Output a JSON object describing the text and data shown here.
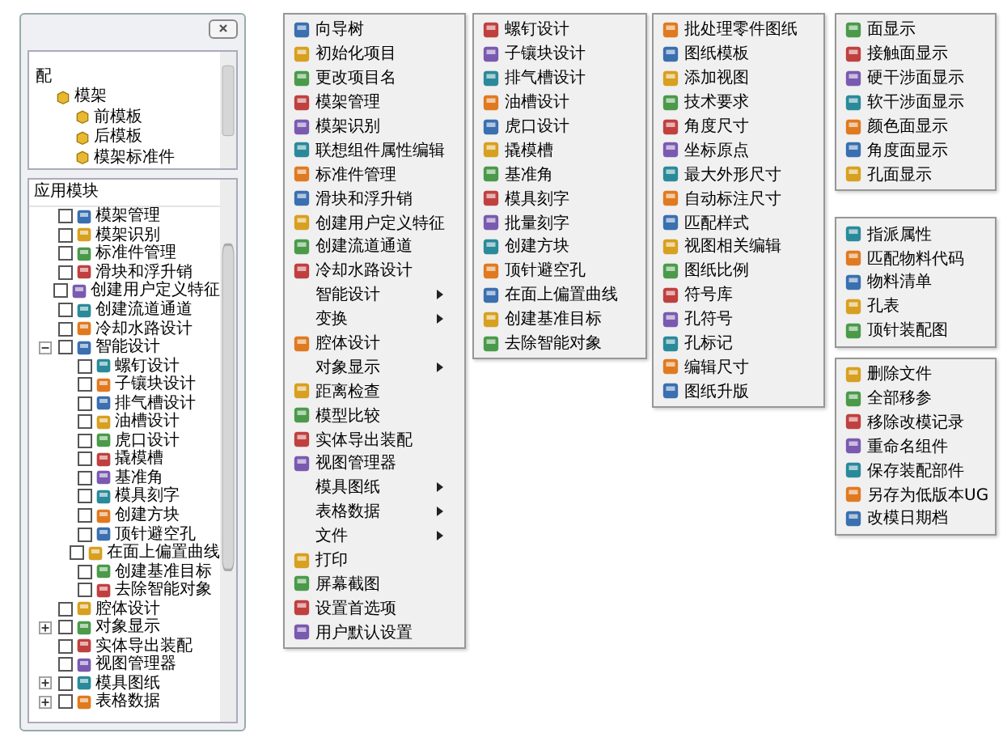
{
  "panel": {
    "top_tree": [
      {
        "label": "配",
        "children": [
          {
            "label": "模架",
            "children": [
              {
                "label": "前模板"
              },
              {
                "label": "后模板"
              },
              {
                "label": "模架标准件"
              }
            ]
          }
        ]
      }
    ],
    "app_modules": {
      "header": "应用模块",
      "items": [
        {
          "label": "模架管理",
          "checked": false
        },
        {
          "label": "模架识别",
          "checked": false
        },
        {
          "label": "标准件管理",
          "checked": false
        },
        {
          "label": "滑块和浮升销",
          "checked": false
        },
        {
          "label": "创建用户定义特征",
          "checked": false
        },
        {
          "label": "创建流道通道",
          "checked": false
        },
        {
          "label": "冷却水路设计",
          "checked": false
        },
        {
          "label": "智能设计",
          "checked": false,
          "expanded": true,
          "children": [
            {
              "label": "螺钉设计",
              "checked": false
            },
            {
              "label": "子镶块设计",
              "checked": false
            },
            {
              "label": "排气槽设计",
              "checked": false
            },
            {
              "label": "油槽设计",
              "checked": false
            },
            {
              "label": "虎口设计",
              "checked": false
            },
            {
              "label": "撬模槽",
              "checked": false
            },
            {
              "label": "基准角",
              "checked": false
            },
            {
              "label": "模具刻字",
              "checked": false
            },
            {
              "label": "创建方块",
              "checked": false
            },
            {
              "label": "顶针避空孔",
              "checked": false
            },
            {
              "label": "在面上偏置曲线",
              "checked": false
            },
            {
              "label": "创建基准目标",
              "checked": false
            },
            {
              "label": "去除智能对象",
              "checked": false
            }
          ]
        },
        {
          "label": "腔体设计",
          "checked": false
        },
        {
          "label": "对象显示",
          "checked": false,
          "expanded": false
        },
        {
          "label": "实体导出装配",
          "checked": false
        },
        {
          "label": "视图管理器",
          "checked": false
        },
        {
          "label": "模具图纸",
          "checked": false,
          "expanded": false
        },
        {
          "label": "表格数据",
          "checked": false,
          "expanded": false
        }
      ]
    }
  },
  "menus": [
    {
      "items": [
        {
          "label": "向导树",
          "kind": "command"
        },
        {
          "label": "初始化项目",
          "kind": "command"
        },
        {
          "label": "更改项目名",
          "kind": "command"
        },
        {
          "label": "模架管理",
          "kind": "command"
        },
        {
          "label": "模架识别",
          "kind": "command"
        },
        {
          "label": "联想组件属性编辑",
          "kind": "command"
        },
        {
          "label": "标准件管理",
          "kind": "command"
        },
        {
          "label": "滑块和浮升销",
          "kind": "command"
        },
        {
          "label": "创建用户定义特征",
          "kind": "command"
        },
        {
          "label": "创建流道通道",
          "kind": "command"
        },
        {
          "label": "冷却水路设计",
          "kind": "command"
        },
        {
          "label": "智能设计",
          "kind": "submenu"
        },
        {
          "label": "变换",
          "kind": "submenu"
        },
        {
          "label": "腔体设计",
          "kind": "command"
        },
        {
          "label": "对象显示",
          "kind": "submenu"
        },
        {
          "label": "距离检查",
          "kind": "command"
        },
        {
          "label": "模型比较",
          "kind": "command"
        },
        {
          "label": "实体导出装配",
          "kind": "command"
        },
        {
          "label": "视图管理器",
          "kind": "command"
        },
        {
          "label": "模具图纸",
          "kind": "submenu"
        },
        {
          "label": "表格数据",
          "kind": "submenu"
        },
        {
          "label": "文件",
          "kind": "submenu"
        },
        {
          "label": "打印",
          "kind": "command"
        },
        {
          "label": "屏幕截图",
          "kind": "command"
        },
        {
          "label": "设置首选项",
          "kind": "command"
        },
        {
          "label": "用户默认设置",
          "kind": "command"
        }
      ]
    },
    {
      "items": [
        {
          "label": "螺钉设计",
          "kind": "command"
        },
        {
          "label": "子镶块设计",
          "kind": "command"
        },
        {
          "label": "排气槽设计",
          "kind": "command"
        },
        {
          "label": "油槽设计",
          "kind": "command"
        },
        {
          "label": "虎口设计",
          "kind": "command"
        },
        {
          "label": "撬模槽",
          "kind": "command"
        },
        {
          "label": "基准角",
          "kind": "command"
        },
        {
          "label": "模具刻字",
          "kind": "command"
        },
        {
          "label": "批量刻字",
          "kind": "command"
        },
        {
          "label": "创建方块",
          "kind": "command"
        },
        {
          "label": "顶针避空孔",
          "kind": "command"
        },
        {
          "label": "在面上偏置曲线",
          "kind": "command"
        },
        {
          "label": "创建基准目标",
          "kind": "command"
        },
        {
          "label": "去除智能对象",
          "kind": "command"
        }
      ]
    },
    {
      "items": [
        {
          "label": "批处理零件图纸",
          "kind": "command"
        },
        {
          "label": "图纸模板",
          "kind": "command"
        },
        {
          "label": "添加视图",
          "kind": "command"
        },
        {
          "label": "技术要求",
          "kind": "command"
        },
        {
          "label": "角度尺寸",
          "kind": "command"
        },
        {
          "label": "坐标原点",
          "kind": "command"
        },
        {
          "label": "最大外形尺寸",
          "kind": "command"
        },
        {
          "label": "自动标注尺寸",
          "kind": "command"
        },
        {
          "label": "匹配样式",
          "kind": "command"
        },
        {
          "label": "视图相关编辑",
          "kind": "command"
        },
        {
          "label": "图纸比例",
          "kind": "command"
        },
        {
          "label": "符号库",
          "kind": "command"
        },
        {
          "label": "孔符号",
          "kind": "command"
        },
        {
          "label": "孔标记",
          "kind": "command"
        },
        {
          "label": "编辑尺寸",
          "kind": "command"
        },
        {
          "label": "图纸升版",
          "kind": "command"
        }
      ]
    },
    {
      "items": [
        {
          "label": "面显示",
          "kind": "command"
        },
        {
          "label": "接触面显示",
          "kind": "command"
        },
        {
          "label": "硬干涉面显示",
          "kind": "command"
        },
        {
          "label": "软干涉面显示",
          "kind": "command"
        },
        {
          "label": "颜色面显示",
          "kind": "command"
        },
        {
          "label": "角度面显示",
          "kind": "command"
        },
        {
          "label": "孔面显示",
          "kind": "command"
        }
      ]
    },
    {
      "items": [
        {
          "label": "指派属性",
          "kind": "command"
        },
        {
          "label": "匹配物料代码",
          "kind": "command"
        },
        {
          "label": "物料清单",
          "kind": "command"
        },
        {
          "label": "孔表",
          "kind": "command"
        },
        {
          "label": "顶针装配图",
          "kind": "command"
        }
      ]
    },
    {
      "items": [
        {
          "label": "删除文件",
          "kind": "command"
        },
        {
          "label": "全部移参",
          "kind": "command"
        },
        {
          "label": "移除改模记录",
          "kind": "command"
        },
        {
          "label": "重命名组件",
          "kind": "command"
        },
        {
          "label": "保存装配部件",
          "kind": "command"
        },
        {
          "label": "另存为低版本UG",
          "kind": "command"
        },
        {
          "label": "改模日期档",
          "kind": "command"
        }
      ]
    }
  ]
}
